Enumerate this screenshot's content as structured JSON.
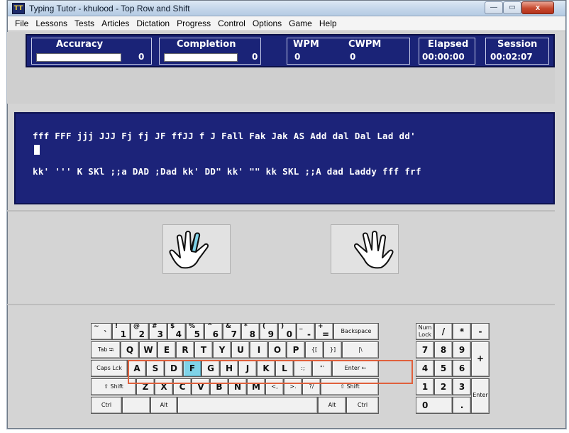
{
  "window": {
    "title": "Typing Tutor - khulood - Top Row and Shift",
    "icon_text": "TT"
  },
  "window_controls": {
    "minimize": "—",
    "maximize": "▭",
    "close": "x"
  },
  "menu": [
    "File",
    "Lessons",
    "Tests",
    "Articles",
    "Dictation",
    "Progress",
    "Control",
    "Options",
    "Game",
    "Help"
  ],
  "stats": {
    "accuracy_label": "Accuracy",
    "accuracy_value": "0",
    "completion_label": "Completion",
    "completion_value": "0",
    "wpm_label": "WPM",
    "wpm_value": "0",
    "cwpm_label": "CWPM",
    "cwpm_value": "0",
    "elapsed_label": "Elapsed",
    "elapsed_value": "00:00:00",
    "session_label": "Session",
    "session_value": "00:02:07"
  },
  "lesson_text": {
    "line1": "fff FFF jjj JJJ Fj fj JF ffJJ f J Fall Fak Jak AS Add dal Dal Lad dd'",
    "line2": "kk' ''' K SKl ;;a DAD ;Dad kk' DD\" kk' \"\" kk SKL ;;A dad Laddy fff frf"
  },
  "hands": {
    "left_highlight_finger": "index",
    "highlight_color": "#7fd3e8"
  },
  "keyboard": {
    "number_row": [
      {
        "top": "~",
        "bot": "`"
      },
      {
        "top": "!",
        "bot": "1"
      },
      {
        "top": "@",
        "bot": "2"
      },
      {
        "top": "#",
        "bot": "3"
      },
      {
        "top": "$",
        "bot": "4"
      },
      {
        "top": "%",
        "bot": "5"
      },
      {
        "top": "^",
        "bot": "6"
      },
      {
        "top": "&",
        "bot": "7"
      },
      {
        "top": "*",
        "bot": "8"
      },
      {
        "top": "(",
        "bot": "9"
      },
      {
        "top": ")",
        "bot": "0"
      },
      {
        "top": "_",
        "bot": "-"
      },
      {
        "top": "+",
        "bot": "="
      }
    ],
    "backspace": "Backspace",
    "tab": "Tab ⭾",
    "top_row": [
      "Q",
      "W",
      "E",
      "R",
      "T",
      "Y",
      "U",
      "I",
      "O",
      "P",
      "{[",
      "}]",
      "|\\"
    ],
    "caps": "Caps Lck",
    "home_row": [
      "A",
      "S",
      "D",
      "F",
      "G",
      "H",
      "J",
      "K",
      "L",
      ":;",
      "\"'"
    ],
    "enter": "Enter ←",
    "shift": "⇧ Shift",
    "bottom_row": [
      "Z",
      "X",
      "C",
      "V",
      "B",
      "N",
      "M",
      "<,",
      ">.",
      "?/"
    ],
    "ctrl": "Ctrl",
    "alt": "Alt",
    "highlighted_key": "F",
    "numpad": {
      "numlock": "Num Lock",
      "slash": "/",
      "star": "*",
      "minus": "-",
      "row1": [
        "7",
        "8",
        "9"
      ],
      "plus": "+",
      "row2": [
        "4",
        "5",
        "6"
      ],
      "row3": [
        "1",
        "2",
        "3"
      ],
      "enter": "Enter",
      "zero": "0",
      "dot": "."
    }
  }
}
